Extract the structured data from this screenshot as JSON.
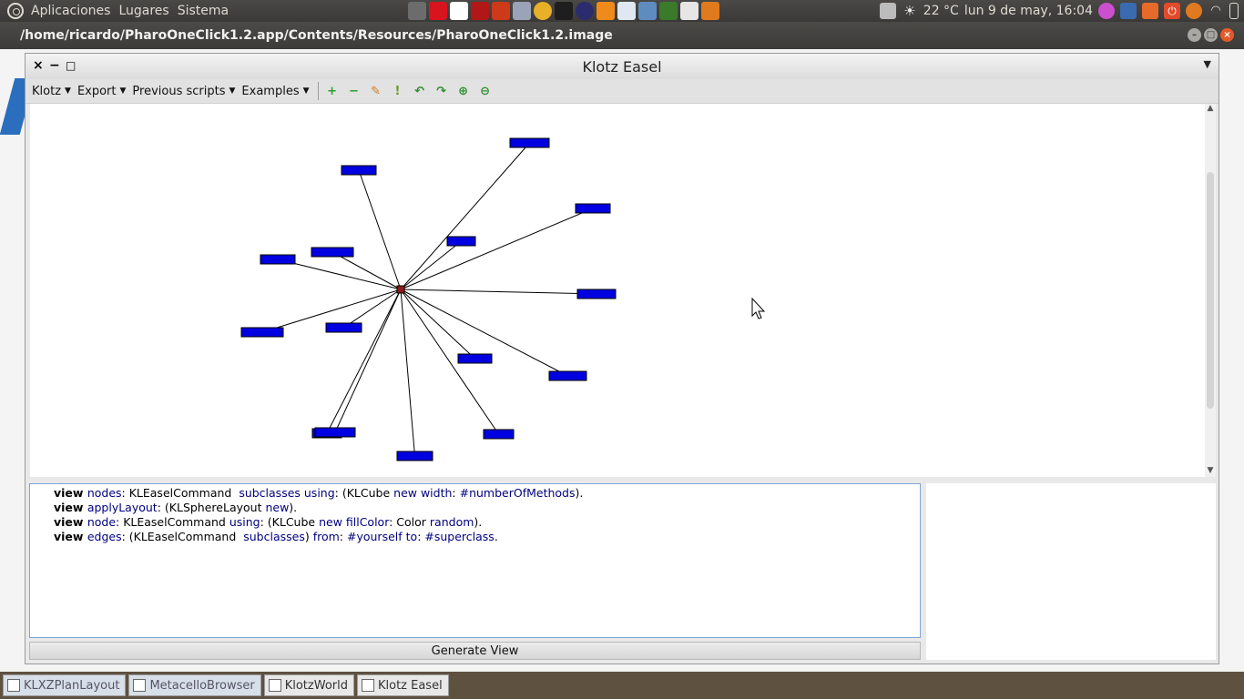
{
  "top_panel": {
    "menus": [
      "Aplicaciones",
      "Lugares",
      "Sistema"
    ],
    "launchers": [
      {
        "icon": "bug-icon",
        "color": "#6c6c6c"
      },
      {
        "icon": "oracle-icon",
        "color": "#d8141e"
      },
      {
        "icon": "fork-icon",
        "color": "#ffffff"
      },
      {
        "icon": "lambda-icon",
        "color": "#b01818"
      },
      {
        "icon": "tool-icon",
        "color": "#cc3a1a"
      },
      {
        "icon": "tex-icon",
        "color": "#9aa3b8"
      },
      {
        "icon": "chrome-icon",
        "color": "#e8b028"
      },
      {
        "icon": "terminal-icon",
        "color": "#1e1e1e"
      },
      {
        "icon": "eclipse-icon",
        "color": "#2b2c6d"
      },
      {
        "icon": "star-icon",
        "color": "#f08a1a"
      },
      {
        "icon": "clock-icon",
        "color": "#dfe8f2"
      },
      {
        "icon": "people-icon",
        "color": "#5f8cc0"
      },
      {
        "icon": "meter-icon",
        "color": "#3a7a2a"
      },
      {
        "icon": "slides-icon",
        "color": "#e6e6e6"
      },
      {
        "icon": "balloon-icon",
        "color": "#e07a1e"
      }
    ],
    "weather": "22 °C",
    "datetime": "lun  9 de may, 16:04",
    "tray": [
      {
        "icon": "trash-icon",
        "color": "#bcbcbc"
      },
      {
        "icon": "sun-icon",
        "color": "#e9e9e9"
      },
      {
        "icon": "monster-icon",
        "color": "#cc4fcf"
      },
      {
        "icon": "grid-icon",
        "color": "#3a6ab0"
      },
      {
        "icon": "folder-icon",
        "color": "#e86a2a"
      },
      {
        "icon": "power-icon",
        "color": "#e24b2a"
      },
      {
        "icon": "balloon-icon",
        "color": "#e07a1e"
      },
      {
        "icon": "wifi-icon",
        "color": "#dfdbd2"
      },
      {
        "icon": "battery-icon",
        "color": "#dfdbd2"
      }
    ]
  },
  "outer_window": {
    "title": "/home/ricardo/PharoOneClick1.2.app/Contents/Resources/PharoOneClick1.2.image"
  },
  "easel": {
    "title": "Klotz Easel",
    "toolbar_menus": [
      "Klotz",
      "Export",
      "Previous scripts",
      "Examples"
    ],
    "toolbar_icons": [
      {
        "icon": "plus-icon",
        "glyph": "+",
        "color": "#2e9e2e"
      },
      {
        "icon": "minus-icon",
        "glyph": "−",
        "color": "#2e9e2e"
      },
      {
        "icon": "pencil-icon",
        "glyph": "✎",
        "color": "#d07a20"
      },
      {
        "icon": "pin-icon",
        "glyph": "!",
        "color": "#6a9a20"
      },
      {
        "icon": "rotate-left-icon",
        "glyph": "↶",
        "color": "#2e8e2e"
      },
      {
        "icon": "rotate-right-icon",
        "glyph": "↷",
        "color": "#2e8e2e"
      },
      {
        "icon": "zoom-in-icon",
        "glyph": "⊕",
        "color": "#2e8e2e"
      },
      {
        "icon": "zoom-out-icon",
        "glyph": "⊖",
        "color": "#2e8e2e"
      }
    ],
    "script": [
      [
        [
          "kw",
          "view "
        ],
        [
          "msg",
          "nodes"
        ],
        [
          "plain",
          ": KLEaselCommand  "
        ],
        [
          "msg",
          "subclasses using"
        ],
        [
          "plain",
          ": (KLCube "
        ],
        [
          "msg",
          "new width"
        ],
        [
          "plain",
          ": "
        ],
        [
          "sym",
          "#numberOfMethods"
        ],
        [
          "plain",
          ")."
        ]
      ],
      [
        [
          "kw",
          "view "
        ],
        [
          "msg",
          "applyLayout"
        ],
        [
          "plain",
          ": (KLSphereLayout "
        ],
        [
          "msg",
          "new"
        ],
        [
          "plain",
          ")."
        ]
      ],
      [
        [
          "kw",
          "view "
        ],
        [
          "msg",
          "node"
        ],
        [
          "plain",
          ": KLEaselCommand "
        ],
        [
          "msg",
          "using"
        ],
        [
          "plain",
          ": (KLCube "
        ],
        [
          "msg",
          "new fillColor"
        ],
        [
          "plain",
          ": Color "
        ],
        [
          "msg",
          "random"
        ],
        [
          "plain",
          ")."
        ]
      ],
      [
        [
          "kw",
          "view "
        ],
        [
          "msg",
          "edges"
        ],
        [
          "plain",
          ": (KLEaselCommand  "
        ],
        [
          "msg",
          "subclasses"
        ],
        [
          "plain",
          ") "
        ],
        [
          "msg",
          "from"
        ],
        [
          "plain",
          ": "
        ],
        [
          "sym",
          "#yourself"
        ],
        [
          "plain",
          " "
        ],
        [
          "msg",
          "to"
        ],
        [
          "plain",
          ": "
        ],
        [
          "sym",
          "#superclass"
        ],
        [
          "plain",
          "."
        ]
      ]
    ],
    "generate_label": "Generate View",
    "graph": {
      "hub_color": "#8b1a1a",
      "node_color": "#0000e0"
    }
  },
  "taskbar": {
    "items": [
      {
        "label": "KLXZPlanLayout",
        "active": false
      },
      {
        "label": "MetacelloBrowser",
        "active": false
      },
      {
        "label": "KlotzWorld",
        "active": true
      },
      {
        "label": "Klotz Easel",
        "active": true
      }
    ]
  }
}
